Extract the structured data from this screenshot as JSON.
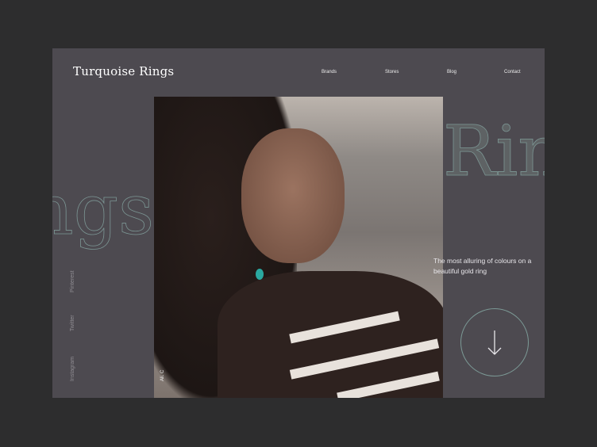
{
  "brand": "Turquoise Rings",
  "nav": [
    "Brands",
    "Stores",
    "Blog",
    "Contact"
  ],
  "decor": {
    "left": "ngs",
    "right": "Rin"
  },
  "social": [
    "Pinterest",
    "Twitter",
    "Instagram"
  ],
  "photo_credit": "Ali. C",
  "tagline": "The most alluring of colours on a beautiful gold ring",
  "colors": {
    "background": "#2d2d2e",
    "card": "#4d4a50",
    "accent": "#7c9a96"
  }
}
